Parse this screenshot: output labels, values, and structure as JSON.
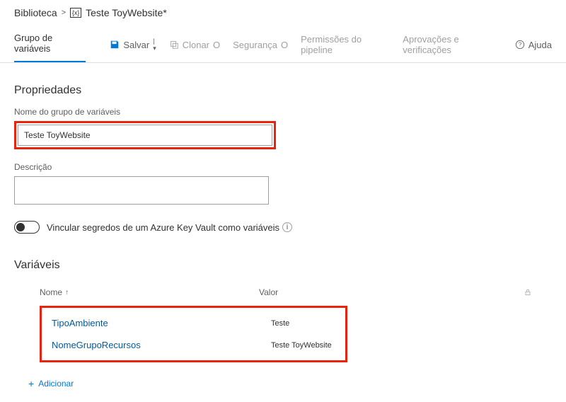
{
  "breadcrumb": {
    "root": "Biblioteca",
    "title": "Teste ToyWebsite*"
  },
  "tabs": {
    "variable_group": "Grupo de variáveis"
  },
  "toolbar": {
    "save": "Salvar",
    "clone": "Clonar",
    "security": "Segurança",
    "pipeline_permissions": "Permissões do pipeline",
    "approvals": "Aprovações e verificações",
    "help": "Ajuda"
  },
  "properties": {
    "heading": "Propriedades",
    "name_label": "Nome do grupo de variáveis",
    "name_value": "Teste ToyWebsite",
    "description_label": "Descrição",
    "description_value": "",
    "keyvault_toggle_label": "Vincular segredos de um Azure Key Vault como variáveis"
  },
  "variables": {
    "heading": "Variáveis",
    "col_name": "Nome",
    "col_value": "Valor",
    "rows": [
      {
        "name": "TipoAmbiente",
        "value": "Teste"
      },
      {
        "name": "NomeGrupoRecursos",
        "value": "Teste ToyWebsite"
      }
    ],
    "add": "Adicionar"
  }
}
